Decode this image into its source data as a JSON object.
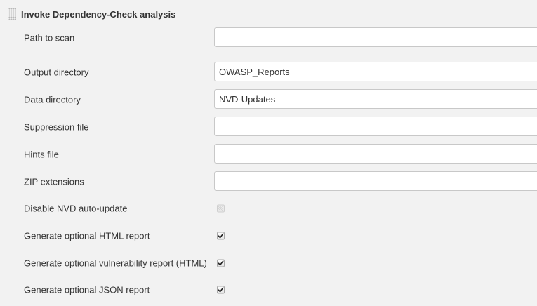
{
  "section": {
    "title": "Invoke Dependency-Check analysis"
  },
  "fields": {
    "path_to_scan": {
      "label": "Path to scan",
      "value": ""
    },
    "output_directory": {
      "label": "Output directory",
      "value": "OWASP_Reports"
    },
    "data_directory": {
      "label": "Data directory",
      "value": "NVD-Updates"
    },
    "suppression_file": {
      "label": "Suppression file",
      "value": ""
    },
    "hints_file": {
      "label": "Hints file",
      "value": ""
    },
    "zip_extensions": {
      "label": "ZIP extensions",
      "value": ""
    }
  },
  "options": {
    "disable_nvd_auto_update": {
      "label": "Disable NVD auto-update",
      "checked": false,
      "disabled": true
    },
    "generate_html_report": {
      "label": "Generate optional HTML report",
      "checked": true
    },
    "generate_vulnerability_report": {
      "label": "Generate optional vulnerability report (HTML)",
      "checked": true
    },
    "generate_json_report": {
      "label": "Generate optional JSON report",
      "checked": true
    }
  }
}
